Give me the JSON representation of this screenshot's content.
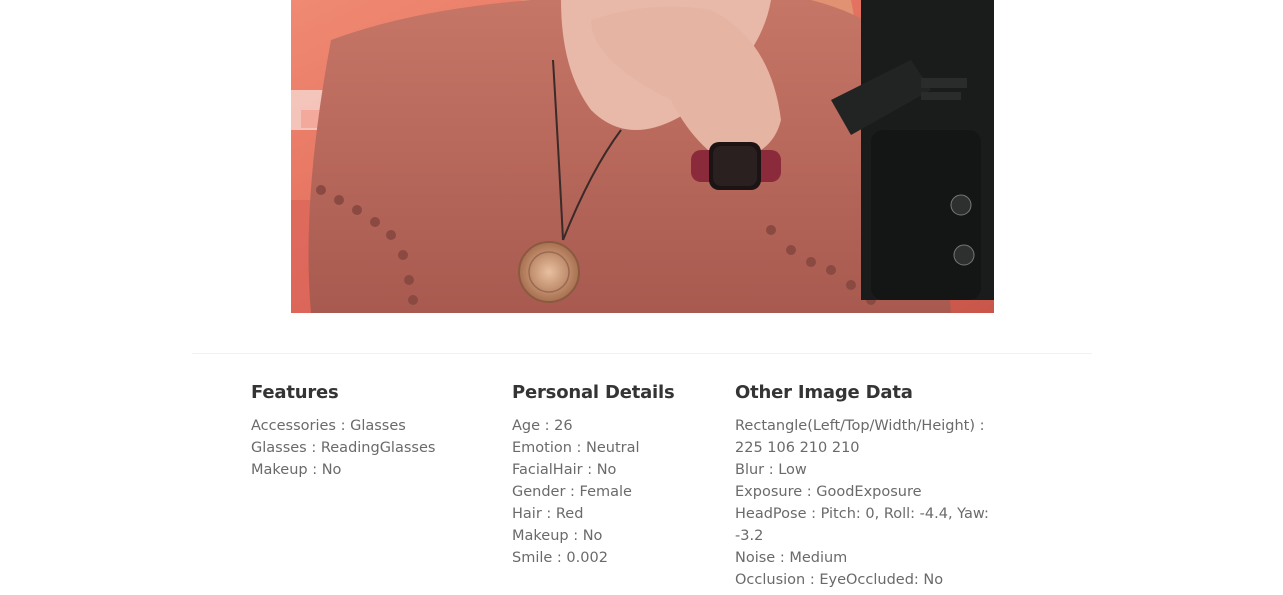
{
  "photo": {
    "kind": "portrait-photo",
    "colors": {
      "background_warm": "#e8806a",
      "dress": "#b86a5e",
      "skin": "#e8b8a8",
      "mic": "#1a1c1c"
    }
  },
  "features": {
    "heading": "Features",
    "items": [
      "Accessories : Glasses",
      "Glasses : ReadingGlasses",
      "Makeup : No"
    ]
  },
  "personal": {
    "heading": "Personal Details",
    "items": [
      "Age : 26",
      "Emotion : Neutral",
      "FacialHair : No",
      "Gender : Female",
      "Hair : Red",
      "Makeup : No",
      "Smile : 0.002"
    ]
  },
  "other": {
    "heading": "Other Image Data",
    "items": [
      "Rectangle(Left/Top/Width/Height) : 225 106 210 210",
      "Blur : Low",
      "Exposure : GoodExposure",
      "HeadPose : Pitch: 0, Roll: -4.4, Yaw: -3.2",
      "Noise : Medium",
      "Occlusion : EyeOccluded: No"
    ]
  }
}
